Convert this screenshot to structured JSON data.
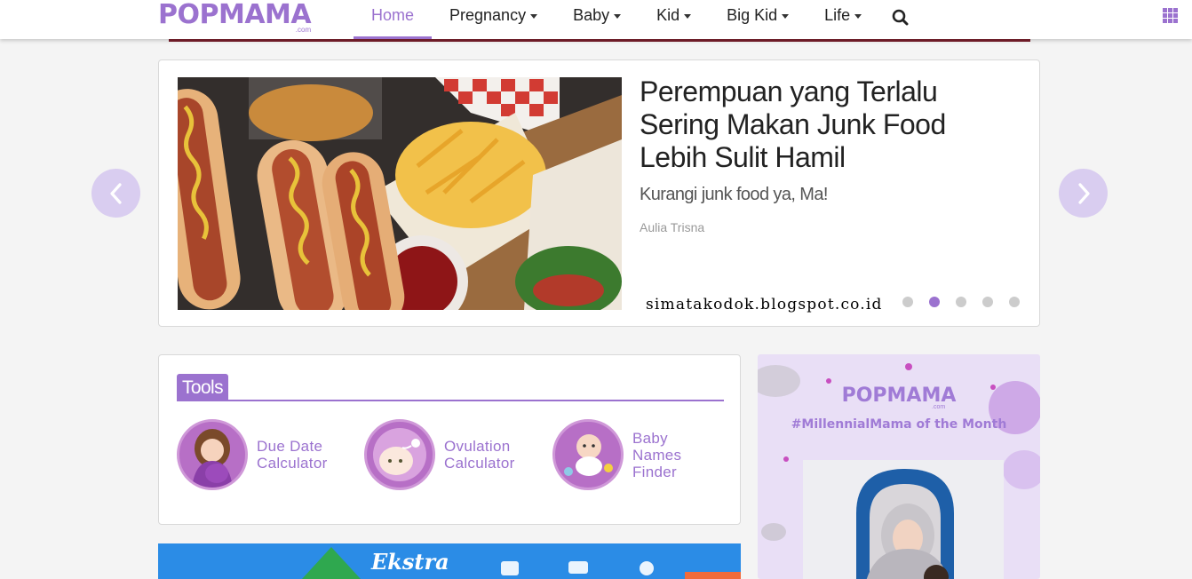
{
  "brand": {
    "logo": "POPMAMA",
    "logo_domain": ".com"
  },
  "nav": {
    "items": [
      {
        "label": "Home",
        "active": true,
        "dropdown": false
      },
      {
        "label": "Pregnancy",
        "active": false,
        "dropdown": true
      },
      {
        "label": "Baby",
        "active": false,
        "dropdown": true
      },
      {
        "label": "Kid",
        "active": false,
        "dropdown": true
      },
      {
        "label": "Big Kid",
        "active": false,
        "dropdown": true
      },
      {
        "label": "Life",
        "active": false,
        "dropdown": true
      }
    ],
    "search_icon": "search-icon",
    "menu_icon": "grid-menu-icon"
  },
  "slider": {
    "title": "Perempuan yang Terlalu Sering Makan Junk Food Lebih Sulit Hamil",
    "subtitle": "Kurangi junk food ya, Ma!",
    "author": "Aulia Trisna",
    "watermark": "simatakodok.blogspot.co.id",
    "slide_count": 5,
    "active_slide": 2
  },
  "tools": {
    "heading": "Tools",
    "items": [
      {
        "label_line1": "Due Date",
        "label_line2": "Calculator",
        "label_line3": ""
      },
      {
        "label_line1": "Ovulation",
        "label_line2": "Calculator",
        "label_line3": ""
      },
      {
        "label_line1": "Baby",
        "label_line2": "Names",
        "label_line3": "Finder"
      }
    ]
  },
  "ad": {
    "logo": "POPMAMA",
    "logo_domain": ".com",
    "tagline": "#MillennialMama of the Month"
  },
  "banner": {
    "text": "Ekstra"
  },
  "colors": {
    "accent": "#9b72cf",
    "arrow_bg": "#d9cdf0",
    "divider": "#7a1f2c",
    "banner": "#2b8ce6"
  }
}
